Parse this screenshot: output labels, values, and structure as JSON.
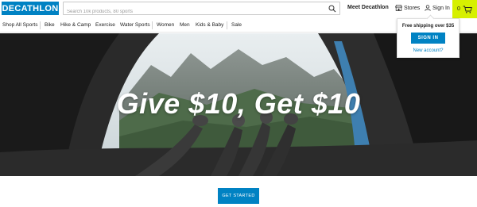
{
  "brand": {
    "logo": "DECATHLON",
    "accent": "#0082c3",
    "cart_accent": "#d6f000"
  },
  "search": {
    "placeholder": "Search 10k products, 80 sports",
    "icon": "search-icon"
  },
  "header_links": {
    "meet": "Meet Decathlon",
    "stores": "Stores",
    "signin": "Sign In",
    "cart_count": "0"
  },
  "nav": {
    "items": [
      "Shop All Sports",
      "Bike",
      "Hike & Camp",
      "Exercise",
      "Water Sports",
      "Women",
      "Men",
      "Kids & Baby",
      "Sale"
    ]
  },
  "hero": {
    "title": "Give $10, Get $10"
  },
  "dropdown": {
    "shipping": "Free shipping over $35",
    "signin_button": "SIGN IN",
    "new_account": "New account?"
  },
  "cta": {
    "label": "GET STARTED"
  }
}
